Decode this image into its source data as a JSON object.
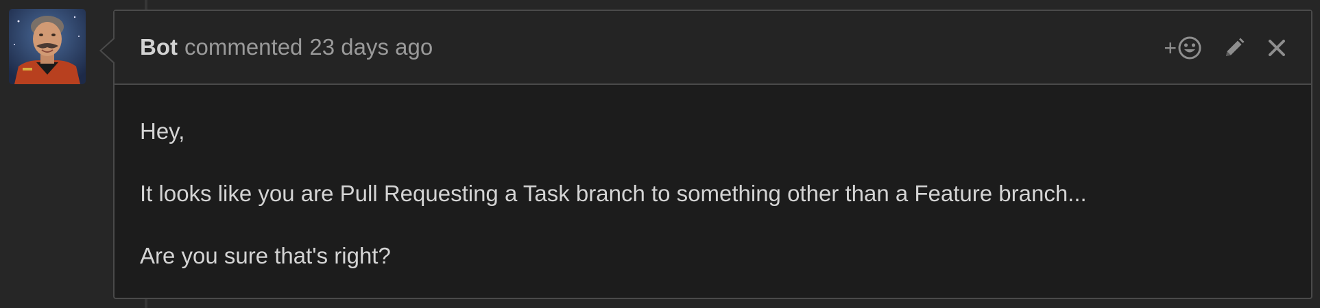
{
  "comment": {
    "author": "Bot",
    "action_text": "commented",
    "timestamp": "23 days ago",
    "body": [
      "Hey,",
      "It looks like you are Pull Requesting a Task branch to something other than a Feature branch...",
      "Are you sure that's right?"
    ]
  },
  "actions": {
    "reaction_plus": "+",
    "icons": [
      "smiley-icon",
      "pencil-icon",
      "close-icon"
    ]
  },
  "avatar": {
    "icon": "avatar-image"
  },
  "colors": {
    "page_bg": "#262626",
    "comment_bg": "#1c1c1c",
    "header_bg": "#242424",
    "border": "#4a4a4a",
    "author_text": "#d2d2d2",
    "meta_text": "#9a9a9a",
    "body_text": "#d4d4d4"
  }
}
